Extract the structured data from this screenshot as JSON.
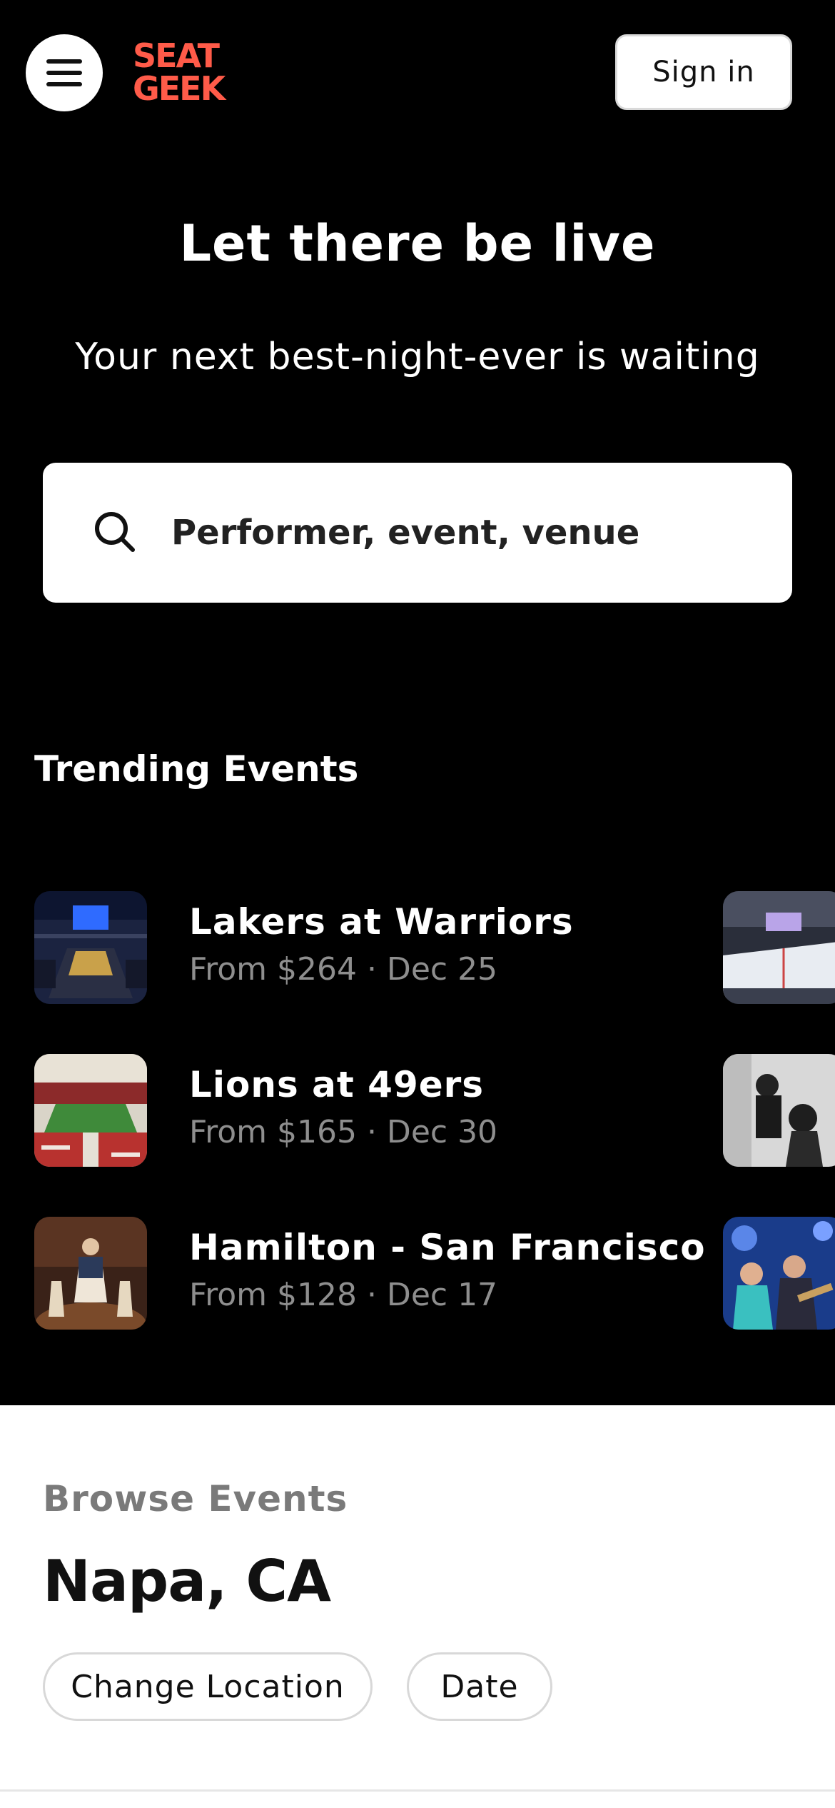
{
  "header": {
    "menu_icon": "hamburger-menu-icon",
    "logo_line1": "SEAT",
    "logo_line2": "GEEK",
    "sign_in_label": "Sign in",
    "brand_color": "#ff5b49"
  },
  "hero": {
    "headline": "Let there be live",
    "subline": "Your next best-night-ever is waiting",
    "search_icon": "search-icon",
    "search_placeholder": "Performer, event, venue"
  },
  "trending": {
    "title": "Trending Events",
    "events": [
      {
        "name": "Lakers at Warriors",
        "meta": "From $264 · Dec 25",
        "image": "basketball-arena-photo"
      },
      {
        "name": "Lions at 49ers",
        "meta": "From $165 · Dec 30",
        "image": "football-stadium-photo"
      },
      {
        "name": "Hamilton - San Francisco",
        "meta": "From $128 · Dec 17",
        "image": "theater-stage-photo"
      }
    ],
    "next_column_images": [
      "hockey-rink-photo",
      "musicians-bw-photo",
      "concert-performers-photo"
    ]
  },
  "browse": {
    "label": "Browse Events",
    "city": "Napa, CA",
    "change_location_label": "Change Location",
    "date_label": "Date"
  }
}
